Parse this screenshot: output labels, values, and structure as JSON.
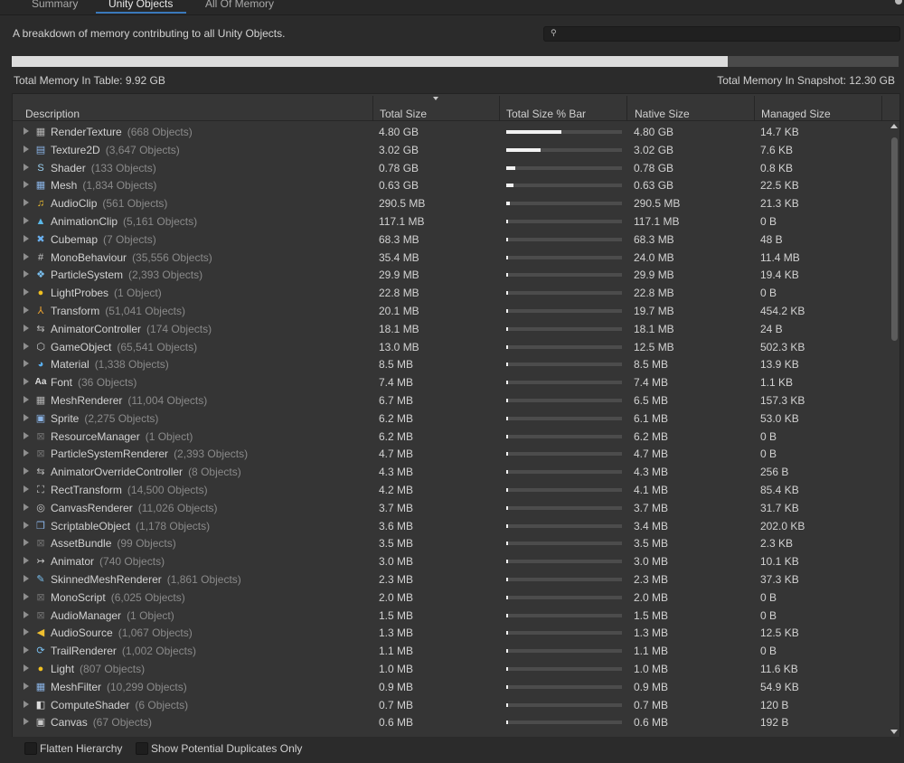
{
  "tabs": {
    "summary": "Summary",
    "unity_objects": "Unity Objects",
    "all_memory": "All Of Memory"
  },
  "description": "A breakdown of memory contributing to all Unity Objects.",
  "search": {
    "value": ""
  },
  "memory_bar": {
    "fraction": 0.807
  },
  "totals": {
    "in_table": "Total Memory In Table: 9.92 GB",
    "in_snapshot": "Total Memory In Snapshot: 12.30 GB"
  },
  "columns": {
    "description": "Description",
    "total_size": "Total Size",
    "bar": "Total Size % Bar",
    "native": "Native Size",
    "managed": "Managed Size"
  },
  "rows": [
    {
      "name": "RenderTexture",
      "count": "(668 Objects)",
      "total": "4.80 GB",
      "bar": 0.48,
      "native": "4.80 GB",
      "managed": "14.7 KB",
      "icon": "render-texture",
      "glyph": "▦",
      "color": "#b4b4b4"
    },
    {
      "name": "Texture2D",
      "count": "(3,647 Objects)",
      "total": "3.02 GB",
      "bar": 0.3,
      "native": "3.02 GB",
      "managed": "7.6 KB",
      "icon": "texture2d",
      "glyph": "▤",
      "color": "#8ab4e6"
    },
    {
      "name": "Shader",
      "count": "(133 Objects)",
      "total": "0.78 GB",
      "bar": 0.08,
      "native": "0.78 GB",
      "managed": "0.8 KB",
      "icon": "shader",
      "glyph": "S",
      "color": "#9ad0f0"
    },
    {
      "name": "Mesh",
      "count": "(1,834 Objects)",
      "total": "0.63 GB",
      "bar": 0.065,
      "native": "0.63 GB",
      "managed": "22.5 KB",
      "icon": "mesh",
      "glyph": "▦",
      "color": "#8ab4e6"
    },
    {
      "name": "AudioClip",
      "count": "(561 Objects)",
      "total": "290.5 MB",
      "bar": 0.03,
      "native": "290.5 MB",
      "managed": "21.3 KB",
      "icon": "audio-clip",
      "glyph": "♫",
      "color": "#f0c030"
    },
    {
      "name": "AnimationClip",
      "count": "(5,161 Objects)",
      "total": "117.1 MB",
      "bar": 0.015,
      "native": "117.1 MB",
      "managed": "0 B",
      "icon": "animation-clip",
      "glyph": "▲",
      "color": "#5ab8e8"
    },
    {
      "name": "Cubemap",
      "count": "(7 Objects)",
      "total": "68.3 MB",
      "bar": 0.01,
      "native": "68.3 MB",
      "managed": "48 B",
      "icon": "cubemap",
      "glyph": "✖",
      "color": "#6ab0f0"
    },
    {
      "name": "MonoBehaviour",
      "count": "(35,556 Objects)",
      "total": "35.4 MB",
      "bar": 0.01,
      "native": "24.0 MB",
      "managed": "11.4 MB",
      "icon": "mono-behaviour",
      "glyph": "#",
      "color": "#c8c8c8"
    },
    {
      "name": "ParticleSystem",
      "count": "(2,393 Objects)",
      "total": "29.9 MB",
      "bar": 0.01,
      "native": "29.9 MB",
      "managed": "19.4 KB",
      "icon": "particle-system",
      "glyph": "❖",
      "color": "#7ac0f0"
    },
    {
      "name": "LightProbes",
      "count": "(1 Object)",
      "total": "22.8 MB",
      "bar": 0.01,
      "native": "22.8 MB",
      "managed": "0 B",
      "icon": "light-probes",
      "glyph": "●",
      "color": "#f0c020"
    },
    {
      "name": "Transform",
      "count": "(51,041 Objects)",
      "total": "20.1 MB",
      "bar": 0.01,
      "native": "19.7 MB",
      "managed": "454.2 KB",
      "icon": "transform",
      "glyph": "⅄",
      "color": "#e8a030"
    },
    {
      "name": "AnimatorController",
      "count": "(174 Objects)",
      "total": "18.1 MB",
      "bar": 0.01,
      "native": "18.1 MB",
      "managed": "24 B",
      "icon": "animator-controller",
      "glyph": "⇆",
      "color": "#b8b8b8"
    },
    {
      "name": "GameObject",
      "count": "(65,541 Objects)",
      "total": "13.0 MB",
      "bar": 0.01,
      "native": "12.5 MB",
      "managed": "502.3 KB",
      "icon": "game-object",
      "glyph": "⬡",
      "color": "#c8c8c8"
    },
    {
      "name": "Material",
      "count": "(1,338 Objects)",
      "total": "8.5 MB",
      "bar": 0.01,
      "native": "8.5 MB",
      "managed": "13.9 KB",
      "icon": "material",
      "glyph": "◕",
      "color": "#5ab0f0"
    },
    {
      "name": "Font",
      "count": "(36 Objects)",
      "total": "7.4 MB",
      "bar": 0.01,
      "native": "7.4 MB",
      "managed": "1.1 KB",
      "icon": "font",
      "glyph": "Aa",
      "color": "#dcdcdc"
    },
    {
      "name": "MeshRenderer",
      "count": "(11,004 Objects)",
      "total": "6.7 MB",
      "bar": 0.01,
      "native": "6.5 MB",
      "managed": "157.3 KB",
      "icon": "mesh-renderer",
      "glyph": "▦",
      "color": "#b4b4b4"
    },
    {
      "name": "Sprite",
      "count": "(2,275 Objects)",
      "total": "6.2 MB",
      "bar": 0.01,
      "native": "6.1 MB",
      "managed": "53.0 KB",
      "icon": "sprite",
      "glyph": "▣",
      "color": "#8ab4e6"
    },
    {
      "name": "ResourceManager",
      "count": "(1 Object)",
      "total": "6.2 MB",
      "bar": 0.01,
      "native": "6.2 MB",
      "managed": "0 B",
      "icon": "resource-manager",
      "glyph": "⊠",
      "color": "#6e6e6e"
    },
    {
      "name": "ParticleSystemRenderer",
      "count": "(2,393 Objects)",
      "total": "4.7 MB",
      "bar": 0.01,
      "native": "4.7 MB",
      "managed": "0 B",
      "icon": "particle-system-renderer",
      "glyph": "⊠",
      "color": "#6e6e6e"
    },
    {
      "name": "AnimatorOverrideController",
      "count": "(8 Objects)",
      "total": "4.3 MB",
      "bar": 0.01,
      "native": "4.3 MB",
      "managed": "256 B",
      "icon": "animator-override-controller",
      "glyph": "⇆",
      "color": "#b8b8b8"
    },
    {
      "name": "RectTransform",
      "count": "(14,500 Objects)",
      "total": "4.2 MB",
      "bar": 0.01,
      "native": "4.1 MB",
      "managed": "85.4 KB",
      "icon": "rect-transform",
      "glyph": "⛶",
      "color": "#c8c8c8"
    },
    {
      "name": "CanvasRenderer",
      "count": "(11,026 Objects)",
      "total": "3.7 MB",
      "bar": 0.01,
      "native": "3.7 MB",
      "managed": "31.7 KB",
      "icon": "canvas-renderer",
      "glyph": "◎",
      "color": "#c8c8c8"
    },
    {
      "name": "ScriptableObject",
      "count": "(1,178 Objects)",
      "total": "3.6 MB",
      "bar": 0.01,
      "native": "3.4 MB",
      "managed": "202.0 KB",
      "icon": "scriptable-object",
      "glyph": "❒",
      "color": "#8ab4e6"
    },
    {
      "name": "AssetBundle",
      "count": "(99 Objects)",
      "total": "3.5 MB",
      "bar": 0.01,
      "native": "3.5 MB",
      "managed": "2.3 KB",
      "icon": "asset-bundle",
      "glyph": "⊠",
      "color": "#6e6e6e"
    },
    {
      "name": "Animator",
      "count": "(740 Objects)",
      "total": "3.0 MB",
      "bar": 0.01,
      "native": "3.0 MB",
      "managed": "10.1 KB",
      "icon": "animator",
      "glyph": "↣",
      "color": "#c8c8c8"
    },
    {
      "name": "SkinnedMeshRenderer",
      "count": "(1,861 Objects)",
      "total": "2.3 MB",
      "bar": 0.01,
      "native": "2.3 MB",
      "managed": "37.3 KB",
      "icon": "skinned-mesh-renderer",
      "glyph": "✎",
      "color": "#7ac0f0"
    },
    {
      "name": "MonoScript",
      "count": "(6,025 Objects)",
      "total": "2.0 MB",
      "bar": 0.01,
      "native": "2.0 MB",
      "managed": "0 B",
      "icon": "mono-script",
      "glyph": "⊠",
      "color": "#6e6e6e"
    },
    {
      "name": "AudioManager",
      "count": "(1 Object)",
      "total": "1.5 MB",
      "bar": 0.01,
      "native": "1.5 MB",
      "managed": "0 B",
      "icon": "audio-manager",
      "glyph": "⊠",
      "color": "#6e6e6e"
    },
    {
      "name": "AudioSource",
      "count": "(1,067 Objects)",
      "total": "1.3 MB",
      "bar": 0.01,
      "native": "1.3 MB",
      "managed": "12.5 KB",
      "icon": "audio-source",
      "glyph": "◀",
      "color": "#f0c030"
    },
    {
      "name": "TrailRenderer",
      "count": "(1,002 Objects)",
      "total": "1.1 MB",
      "bar": 0.01,
      "native": "1.1 MB",
      "managed": "0 B",
      "icon": "trail-renderer",
      "glyph": "⟳",
      "color": "#7ac0f0"
    },
    {
      "name": "Light",
      "count": "(807 Objects)",
      "total": "1.0 MB",
      "bar": 0.01,
      "native": "1.0 MB",
      "managed": "11.6 KB",
      "icon": "light",
      "glyph": "●",
      "color": "#f0c020"
    },
    {
      "name": "MeshFilter",
      "count": "(10,299 Objects)",
      "total": "0.9 MB",
      "bar": 0.01,
      "native": "0.9 MB",
      "managed": "54.9 KB",
      "icon": "mesh-filter",
      "glyph": "▦",
      "color": "#8ab4e6"
    },
    {
      "name": "ComputeShader",
      "count": "(6 Objects)",
      "total": "0.7 MB",
      "bar": 0.01,
      "native": "0.7 MB",
      "managed": "120 B",
      "icon": "compute-shader",
      "glyph": "◧",
      "color": "#dcdcdc"
    },
    {
      "name": "Canvas",
      "count": "(67 Objects)",
      "total": "0.6 MB",
      "bar": 0.01,
      "native": "0.6 MB",
      "managed": "192 B",
      "icon": "canvas",
      "glyph": "▣",
      "color": "#c8c8c8"
    }
  ],
  "footer": {
    "flatten": "Flatten Hierarchy",
    "duplicates": "Show Potential Duplicates Only"
  }
}
